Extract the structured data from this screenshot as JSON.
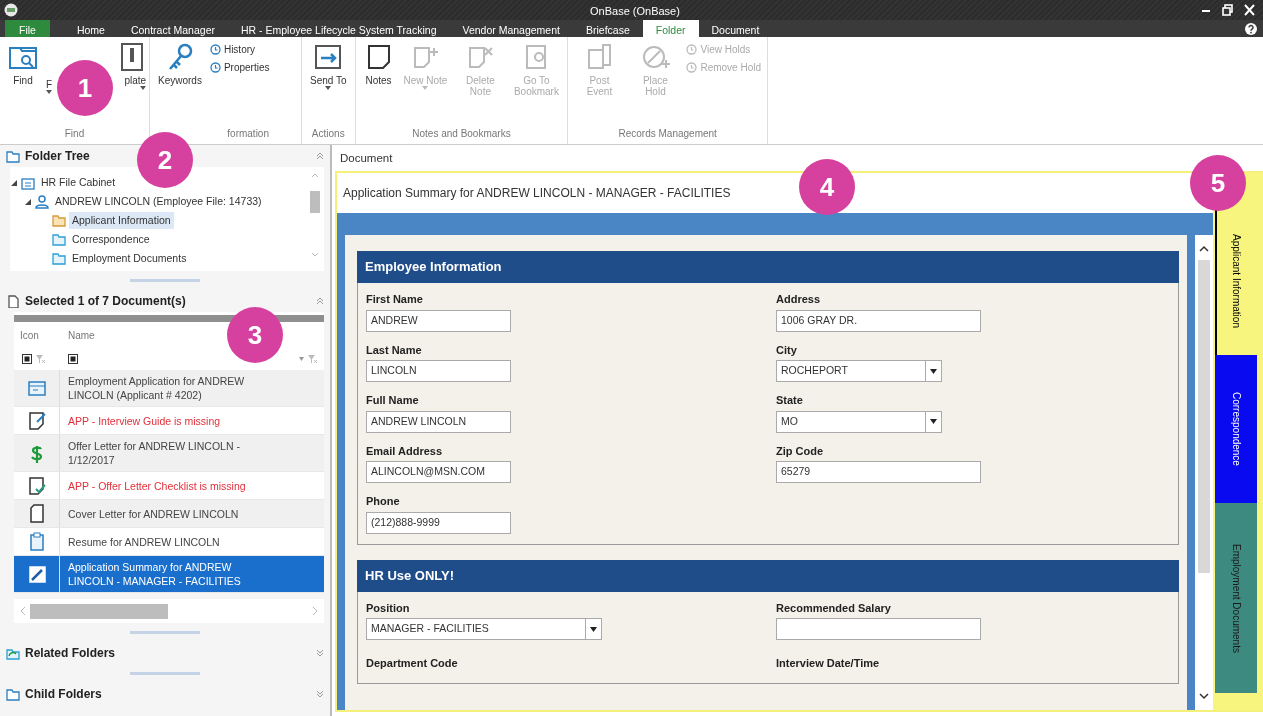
{
  "window": {
    "title": "OnBase (OnBase)"
  },
  "menu_tabs": [
    {
      "label": "File",
      "kind": "file",
      "selected": false
    },
    {
      "label": "Home",
      "kind": "tab",
      "selected": false
    },
    {
      "label": "Contract Manager",
      "kind": "tab",
      "selected": false
    },
    {
      "label": "HR - Employee Lifecycle System Tracking",
      "kind": "tab",
      "selected": false
    },
    {
      "label": "Vendor Management",
      "kind": "tab",
      "selected": false
    },
    {
      "label": "Briefcase",
      "kind": "tab",
      "selected": false
    },
    {
      "label": "Folder",
      "kind": "tab",
      "selected": true
    },
    {
      "label": "Document",
      "kind": "tab",
      "selected": false
    }
  ],
  "ribbon_groups": [
    {
      "label": "Find",
      "buttons": [
        {
          "label": "Find",
          "kind": "large",
          "disabled": false,
          "dropdown": false
        },
        {
          "label": "F",
          "kind": "large",
          "disabled": false,
          "dropdown": true
        },
        {
          "label": "plate",
          "kind": "large",
          "disabled": false,
          "dropdown": true
        }
      ]
    },
    {
      "label": "formation",
      "buttons": [
        {
          "label": "Keywords",
          "kind": "large",
          "disabled": false,
          "dropdown": false
        },
        {
          "label": "History",
          "kind": "small",
          "disabled": false,
          "dropdown": false
        },
        {
          "label": "Properties",
          "kind": "small",
          "disabled": false,
          "dropdown": false
        }
      ]
    },
    {
      "label": "Actions",
      "buttons": [
        {
          "label": "Send To",
          "kind": "large",
          "disabled": false,
          "dropdown": true
        }
      ]
    },
    {
      "label": "Notes and Bookmarks",
      "buttons": [
        {
          "label": "Notes",
          "kind": "large",
          "disabled": false,
          "dropdown": false
        },
        {
          "label": "New Note",
          "kind": "large",
          "disabled": true,
          "dropdown": true
        },
        {
          "label": "Delete Note",
          "kind": "large",
          "disabled": true,
          "dropdown": false
        },
        {
          "label": "Go To Bookmark",
          "kind": "large",
          "disabled": true,
          "dropdown": false
        }
      ]
    },
    {
      "label": "Records Management",
      "buttons": [
        {
          "label": "Post Event",
          "kind": "large",
          "disabled": true,
          "dropdown": false
        },
        {
          "label": "Place Hold",
          "kind": "large",
          "disabled": true,
          "dropdown": false
        },
        {
          "label": "View Holds",
          "kind": "small",
          "disabled": true,
          "dropdown": false
        },
        {
          "label": "Remove Hold",
          "kind": "small",
          "disabled": true,
          "dropdown": false
        }
      ]
    }
  ],
  "folder_tree": {
    "title": "Folder Tree",
    "expanded": true,
    "items": [
      {
        "label": "HR File Cabinet",
        "kind": "cabinet",
        "expanded": true,
        "selected": false,
        "children": [
          {
            "label": "ANDREW LINCOLN (Employee File: 14733)",
            "kind": "person",
            "expanded": true,
            "selected": false,
            "children": [
              {
                "label": "Applicant Information",
                "kind": "folder",
                "selected": true
              },
              {
                "label": "Correspondence",
                "kind": "folder",
                "selected": false
              },
              {
                "label": "Employment Documents",
                "kind": "folder",
                "selected": false
              }
            ]
          }
        ]
      }
    ]
  },
  "documents": {
    "title": "Selected 1 of 7 Document(s)",
    "expanded": true,
    "columns": [
      "Icon",
      "Name"
    ],
    "rows": [
      {
        "name": "Employment Application for ANDREW LINCOLN (Applicant # 4202)",
        "missing": false,
        "selected": false
      },
      {
        "name": "APP - Interview Guide is missing",
        "missing": true,
        "selected": false
      },
      {
        "name": "Offer Letter for ANDREW LINCOLN - 1/12/2017",
        "missing": false,
        "selected": false
      },
      {
        "name": "APP - Offer Letter Checklist is missing",
        "missing": true,
        "selected": false
      },
      {
        "name": "Cover Letter for ANDREW LINCOLN",
        "missing": false,
        "selected": false
      },
      {
        "name": "Resume for ANDREW LINCOLN",
        "missing": false,
        "selected": false
      },
      {
        "name": "Application Summary for ANDREW LINCOLN - MANAGER - FACILITIES",
        "missing": false,
        "selected": true
      }
    ]
  },
  "collapsed_panels": [
    {
      "title": "Related Folders",
      "kind": "related",
      "expanded": false
    },
    {
      "title": "Child Folders",
      "kind": "child",
      "expanded": false
    }
  ],
  "document": {
    "label": "Document",
    "title": "Application Summary for ANDREW LINCOLN - MANAGER - FACILITIES",
    "sections": [
      {
        "title": "Employee Information",
        "rows": [
          [
            {
              "label": "First Name",
              "kind": "text",
              "value": "ANDREW"
            },
            {
              "label": "Address",
              "kind": "text",
              "value": "1006 GRAY DR."
            }
          ],
          [
            {
              "label": "Last Name",
              "kind": "text",
              "value": "LINCOLN"
            },
            {
              "label": "City",
              "kind": "select",
              "value": "ROCHEPORT"
            }
          ],
          [
            {
              "label": "Full Name",
              "kind": "text",
              "value": "ANDREW LINCOLN"
            },
            {
              "label": "State",
              "kind": "select",
              "value": "MO"
            }
          ],
          [
            {
              "label": "Email Address",
              "kind": "text",
              "value": "ALINCOLN@MSN.COM"
            },
            {
              "label": "Zip Code",
              "kind": "text",
              "value": "65279"
            }
          ],
          [
            {
              "label": "Phone",
              "kind": "text",
              "value": "(212)888-9999"
            }
          ]
        ]
      },
      {
        "title": "HR Use ONLY!",
        "rows": [
          [
            {
              "label": "Position",
              "kind": "select",
              "value": "MANAGER - FACILITIES"
            },
            {
              "label": "Recommended Salary",
              "kind": "text"
            }
          ],
          [
            {
              "label": "Department Code"
            },
            {
              "label": "Interview Date/Time"
            }
          ]
        ]
      }
    ],
    "tabs": [
      {
        "label": "Applicant Information",
        "color": "#f8f57e",
        "selected": true
      },
      {
        "label": "Correspondence",
        "color": "#0a0af0",
        "selected": false
      },
      {
        "label": "Employment Documents",
        "color": "#3d8a80",
        "selected": false
      }
    ]
  },
  "callouts": [
    {
      "label": "1"
    },
    {
      "label": "2"
    },
    {
      "label": "3"
    },
    {
      "label": "4"
    },
    {
      "label": "5"
    }
  ]
}
